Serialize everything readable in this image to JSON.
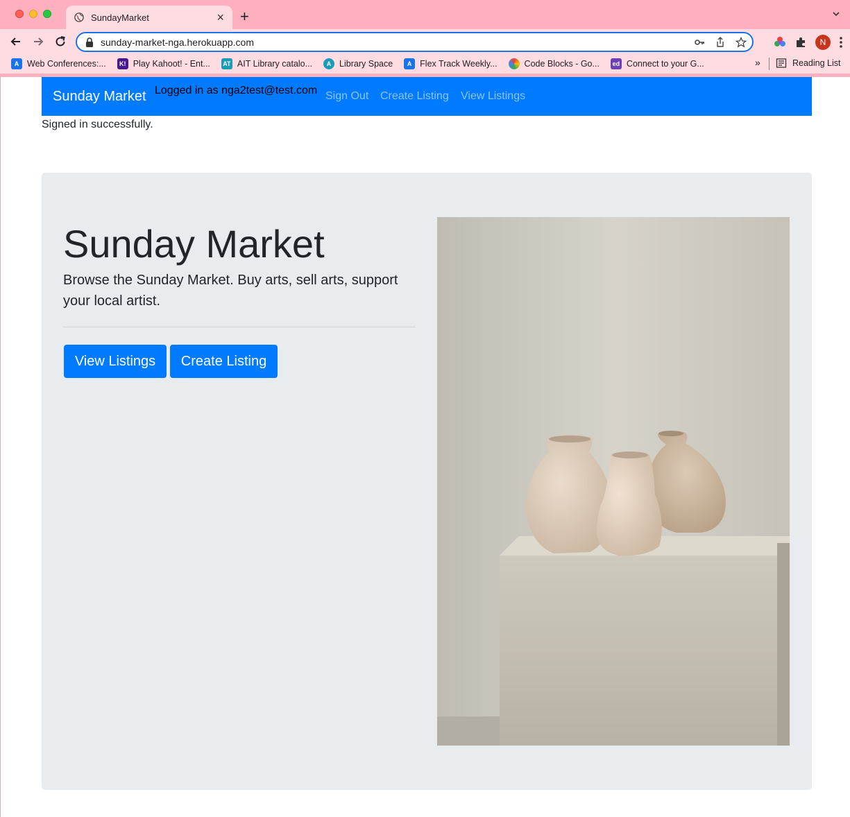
{
  "browser": {
    "tab_title": "SundayMarket",
    "url": "sunday-market-nga.herokuapp.com",
    "profile_initial": "N",
    "bookmarks": [
      {
        "label": "Web Conferences:...",
        "color": "#1a73e8",
        "icon": "ait-icon"
      },
      {
        "label": "Play Kahoot! - Ent...",
        "color": "#46178f",
        "icon": "kahoot-icon"
      },
      {
        "label": "AIT Library catalo...",
        "color": "#1a9cb8",
        "icon": "ait-library-icon"
      },
      {
        "label": "Library Space",
        "color": "#1a9cb8",
        "icon": "ait-icon"
      },
      {
        "label": "Flex Track Weekly...",
        "color": "#1a73e8",
        "icon": "ait-icon"
      },
      {
        "label": "Code Blocks - Go...",
        "color": "#f4b400",
        "icon": "google-sites-icon"
      },
      {
        "label": "Connect to your G...",
        "color": "#6b3fb5",
        "icon": "ed-icon"
      }
    ],
    "more_label": "»",
    "reading_list": "Reading List"
  },
  "navbar": {
    "brand": "Sunday Market",
    "logged_in": "Logged in as nga2test@test.com",
    "links": [
      "Sign Out",
      "Create Listing",
      "View Listings"
    ]
  },
  "flash": "Signed in successfully.",
  "hero": {
    "title": "Sunday Market",
    "lead": "Browse the Sunday Market. Buy arts, sell arts, support your local artist.",
    "buttons": [
      "View Listings",
      "Create Listing"
    ]
  },
  "colors": {
    "primary": "#007bff",
    "jumbotron": "#e9ecef",
    "chrome": "#ffb0bf"
  }
}
